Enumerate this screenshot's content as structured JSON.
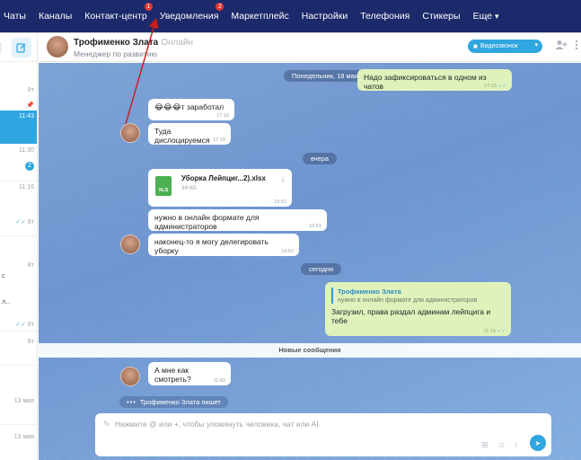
{
  "topnav": {
    "items": [
      {
        "label": "Чаты"
      },
      {
        "label": "Каналы"
      },
      {
        "label": "Контакт-центр",
        "badge": "1"
      },
      {
        "label": "Уведомления",
        "badge": "2"
      },
      {
        "label": "Маркетплейс"
      },
      {
        "label": "Настройки"
      },
      {
        "label": "Телефония"
      },
      {
        "label": "Стикеры"
      },
      {
        "label": "Еще"
      }
    ]
  },
  "sidebar": {
    "rows": [
      {
        "time": "8т",
        "frag": ""
      },
      {
        "time": "11:43",
        "frag": ""
      },
      {
        "time": "11:30",
        "frag": ""
      },
      {
        "time": "2",
        "frag": ""
      },
      {
        "time": "11:16",
        "frag": ""
      },
      {
        "time": "8т",
        "frag": ""
      },
      {
        "time": "8т",
        "frag": "с"
      },
      {
        "time": "8т",
        "frag": "л..."
      },
      {
        "time": "8т",
        "frag": ""
      },
      {
        "time": "13 мая",
        "frag": ""
      },
      {
        "time": "13 мая",
        "frag": ""
      }
    ]
  },
  "header": {
    "name": "Трофименко Злата",
    "status": "Онлайн",
    "role": "Менеджер по развитию",
    "video_label": "Видеозвонок"
  },
  "chat": {
    "date1": "Понедельник, 18 мая",
    "m_out1": {
      "text": "Надо зафиксироваться в одном из чатов",
      "time": "17:15"
    },
    "m_in1": {
      "text": "😂😂😂т заработал",
      "time": "17:16"
    },
    "m_in2": {
      "text": "Туда дислоцируемся",
      "time": "17:16"
    },
    "date2": "вчера",
    "file": {
      "name": "Уборка Лейпциг...2).xlsx",
      "size": "34 КБ",
      "ext": "XLS",
      "time": "19:51"
    },
    "m_in3": {
      "text": "нужно в онлайн формате для администраторов",
      "time": "19:51"
    },
    "m_in4": {
      "text": "наконец-то я могу делегировать уборку",
      "time": "19:52"
    },
    "date3": "сегодня",
    "reply": {
      "quote_name": "Трофименко Злата",
      "quote_text": "нужно в онлайн формате для администраторов",
      "text": "Загрузил, права раздал админам лейпцига и тебе",
      "time": "11:19"
    },
    "new_messages": "Новые сообщения",
    "m_in5": {
      "text": "А мне как смотреть?",
      "time": "11:43"
    },
    "typing": "Трофименко Злата пишет"
  },
  "composer": {
    "placeholder": "Нажмите @ или +, чтобы упомянуть человека, чат или AI"
  },
  "colors": {
    "nav_bg": "#1c2a6b",
    "accent": "#2fa6e0",
    "out_bubble": "#dff2bc",
    "badge": "#e53935",
    "arrow": "#cc1b1b"
  }
}
